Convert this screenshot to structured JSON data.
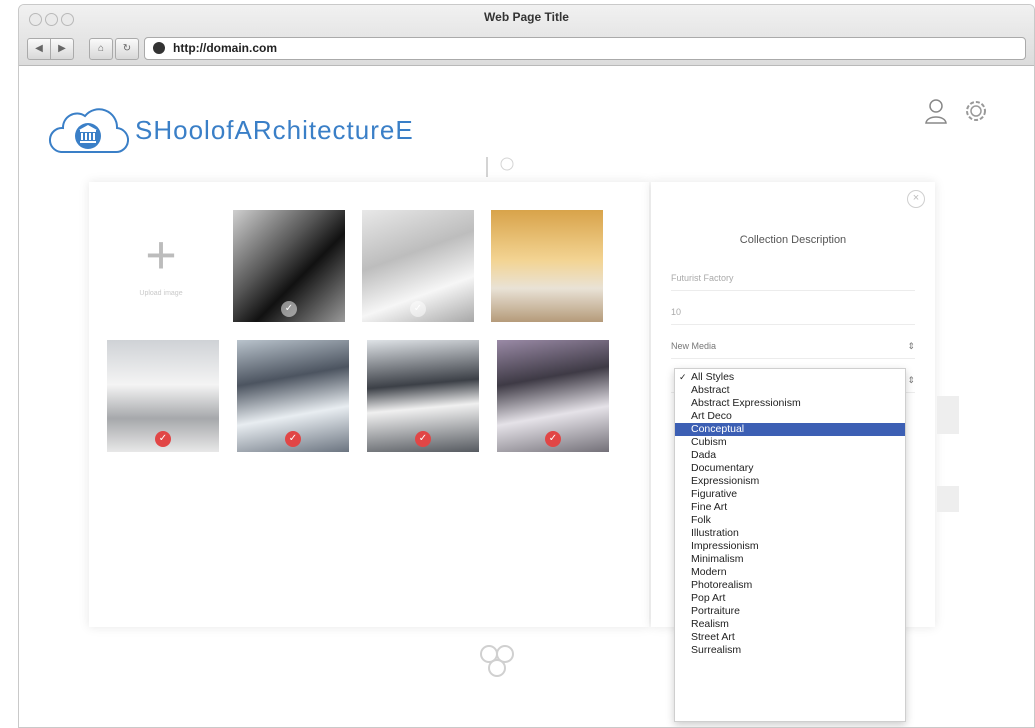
{
  "window": {
    "title": "Web Page Title",
    "url": "http://domain.com"
  },
  "logo": {
    "text": "SHoolofARchitectureE"
  },
  "panel": {
    "title": "Collection Description",
    "name_value": "Futurist Factory",
    "count_value": "10",
    "medium_value": "New Media"
  },
  "add_tile": {
    "label": "Upload image"
  },
  "style_options": [
    "All Styles",
    "Abstract",
    "Abstract Expressionism",
    "Art Deco",
    "Conceptual",
    "Cubism",
    "Dada",
    "Documentary",
    "Expressionism",
    "Figurative",
    "Fine Art",
    "Folk",
    "Illustration",
    "Impressionism",
    "Minimalism",
    "Modern",
    "Photorealism",
    "Pop Art",
    "Portraiture",
    "Realism",
    "Street Art",
    "Surrealism"
  ],
  "style_selected": "All Styles",
  "style_highlight": "Conceptual",
  "colors": {
    "accent": "#3a7fc7",
    "highlight": "#3c5fb4",
    "check": "#e14646"
  }
}
